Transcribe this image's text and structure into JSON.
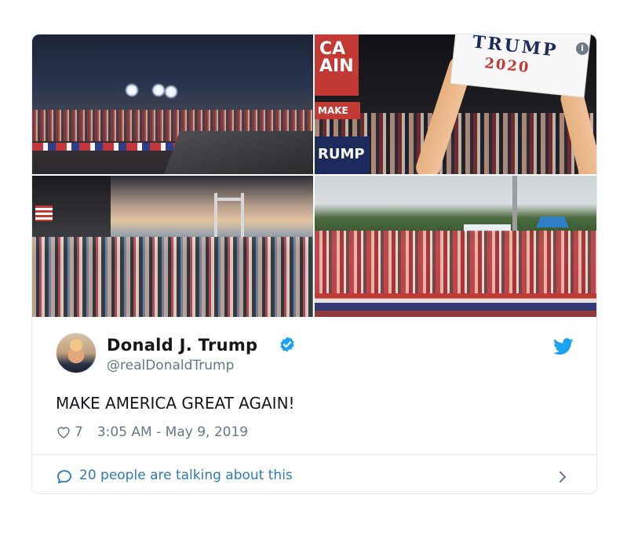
{
  "media": {
    "photos": [
      {
        "name": "rally-photo-stadium-night"
      },
      {
        "name": "rally-photo-signs"
      },
      {
        "name": "rally-photo-sunset-crowd"
      },
      {
        "name": "rally-photo-day-crowd"
      }
    ],
    "sign_left_text": "CA AIN",
    "sign_make_text": "MAKE",
    "sign_trump_bottom": "RUMP",
    "sign_trump_top": "TRUMP",
    "sign_year": "2020",
    "info_glyph": "i"
  },
  "author": {
    "name": "Donald J. Trump",
    "handle": "@realDonaldTrump",
    "verified": true,
    "avatar_icon": "user-avatar"
  },
  "tweet": {
    "text": "MAKE AMERICA GREAT AGAIN!",
    "likes": "7",
    "timestamp": "3:05 AM - May 9, 2019"
  },
  "footer": {
    "conversation_label": "20 people are talking about this"
  },
  "colors": {
    "brand_blue": "#1da1f2",
    "link_blue": "#2b7bb9",
    "muted": "#657786",
    "border": "#e1e8ed"
  }
}
